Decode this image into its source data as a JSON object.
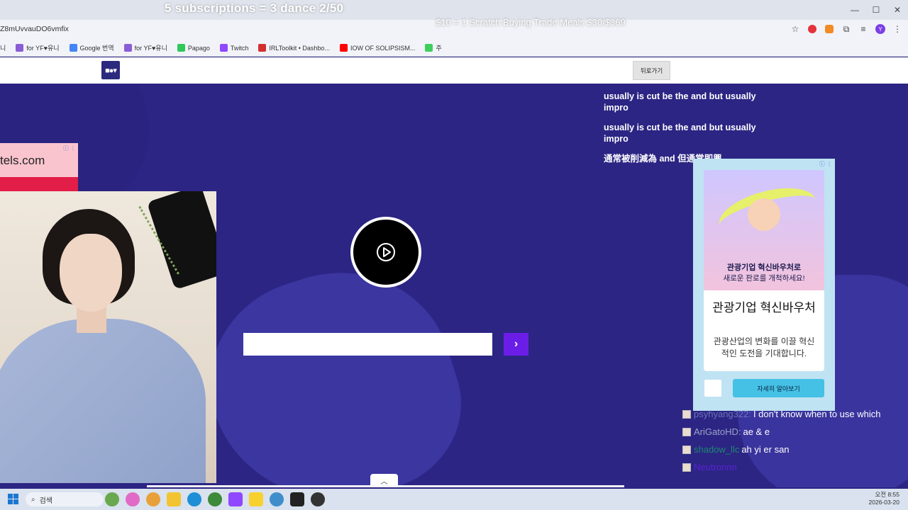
{
  "overlay": {
    "top_text": "5 subscriptions = 3 dance 2/50",
    "price_text": "$10 = 1 Scratch Buying Trade Meals $30/$369"
  },
  "browser": {
    "url": "Z8mUvvauDO6vmfix",
    "bookmarks": [
      {
        "label": "니",
        "icon": "bookmark-icon",
        "color": "#999999"
      },
      {
        "label": "for YF♥유니",
        "icon": "pen-icon",
        "color": "#8a5cd6"
      },
      {
        "label": "Google 번역",
        "icon": "translate-icon",
        "color": "#4285f4"
      },
      {
        "label": "for YF♥유니",
        "icon": "pen-icon",
        "color": "#8a5cd6"
      },
      {
        "label": "Papago",
        "icon": "papago-icon",
        "color": "#2fc85a"
      },
      {
        "label": "Twitch",
        "icon": "twitch-icon",
        "color": "#9146ff"
      },
      {
        "label": "IRLToolkit • Dashbo...",
        "icon": "irltoolkit-icon",
        "color": "#d32f2f"
      },
      {
        "label": "IOW OF SOLIPSISM...",
        "icon": "youtube-icon",
        "color": "#ff0000"
      },
      {
        "label": "주",
        "icon": "calendar-icon",
        "color": "#3ecf5a"
      }
    ]
  },
  "site": {
    "back_label": "뒤로가기"
  },
  "subtitles": [
    "usually is cut be the and but usually impro",
    "usually is cut be the and but usually impro",
    "通常被削減為 and 但通常即興"
  ],
  "ad_left": {
    "text": "tels.com"
  },
  "ad_right": {
    "image_line1": "관광기업 혁신바우처로",
    "image_line2": "새로운 판로를 개척하세요!",
    "heading": "관광기업 혁신바우처",
    "description": "관광산업의 변화를 이끌 혁신적인 도전을 기대합니다.",
    "cta": "자세히 알아보기"
  },
  "chat": [
    {
      "user": "psyhyang322:",
      "message": "I don't know when to use which",
      "color": "user-a"
    },
    {
      "user": "AriGatoHD:",
      "message": "ae & e",
      "color": "user-b"
    },
    {
      "user": "shadow_llc",
      "message": "ah yi er san",
      "color": "user-c"
    },
    {
      "user": "Neutronnn",
      "message": "",
      "color": "user-d"
    }
  ],
  "taskbar": {
    "search_placeholder": "검색",
    "time": "오전 8:55",
    "date": "2026-03-20"
  }
}
